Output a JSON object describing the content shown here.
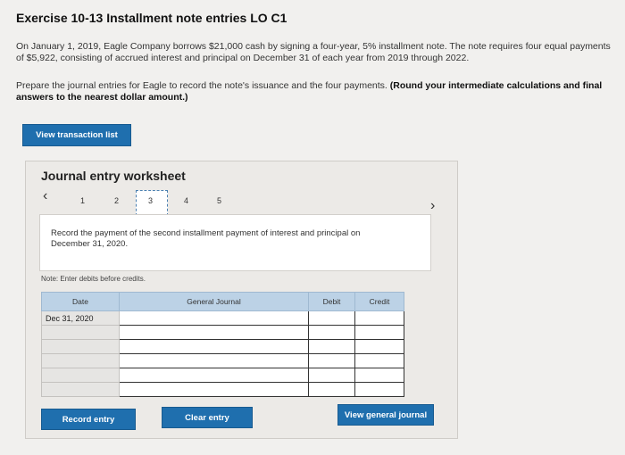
{
  "header": {
    "title": "Exercise 10-13 Installment note entries LO C1"
  },
  "problem": {
    "text": "On January 1, 2019, Eagle Company borrows $21,000 cash by signing a four-year, 5% installment note. The note requires four equal payments of $5,922, consisting of accrued interest and principal on December 31 of each year from 2019 through 2022."
  },
  "instructions": {
    "text": "Prepare the journal entries for Eagle to record the note's issuance and the four payments.",
    "bold": "(Round your intermediate calculations and final answers to the nearest dollar amount.)"
  },
  "buttons": {
    "view_transaction_list": "View transaction list",
    "record_entry": "Record entry",
    "clear_entry": "Clear entry",
    "view_general_journal": "View general journal"
  },
  "worksheet": {
    "title": "Journal entry worksheet",
    "pages": [
      "1",
      "2",
      "3",
      "4",
      "5"
    ],
    "current_page": "3",
    "prev_icon": "chevron-left-icon",
    "next_icon": "chevron-right-icon",
    "task": "Record the payment of the second installment payment of interest and principal on December 31, 2020.",
    "note": "Note: Enter debits before credits."
  },
  "journal_table": {
    "headers": {
      "date": "Date",
      "general_journal": "General Journal",
      "debit": "Debit",
      "credit": "Credit"
    },
    "first_date": "Dec 31, 2020"
  },
  "colors": {
    "button_blue": "#1f6fae",
    "header_blue": "#bcd2e6"
  }
}
